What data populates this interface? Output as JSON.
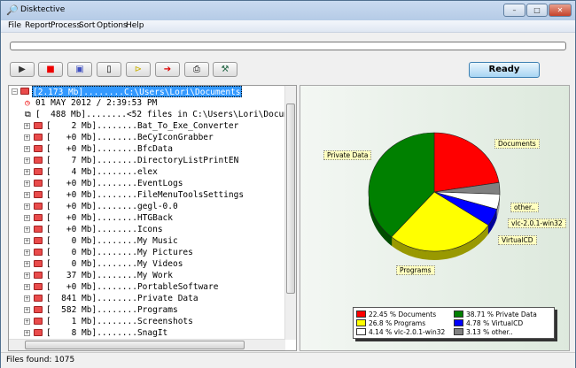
{
  "window": {
    "title": "Disktective",
    "min": "–",
    "max": "□",
    "close": "✕"
  },
  "menu": [
    "File",
    "Report",
    "Process",
    "Sort",
    "Options",
    "Help"
  ],
  "toolbar": {
    "buttons": [
      "play-icon",
      "stop-icon",
      "save-icon",
      "new-document-icon",
      "open-folder-icon",
      "export-icon",
      "print-icon",
      "tools-icon"
    ],
    "status_button": "Ready"
  },
  "progress": 0,
  "tree": {
    "root": "[2.173 Mb]........C:\\Users\\Lori\\Documents",
    "date": "01 MAY 2012 / 2:39:53 PM",
    "files": "[  488 Mb]........<52 files in C:\\Users\\Lori\\Documents>",
    "items": [
      "[    2 Mb]........Bat_To_Exe_Converter",
      "[   +0 Mb]........BeCyIconGrabber",
      "[   +0 Mb]........BfcData",
      "[    7 Mb]........DirectoryListPrintEN",
      "[    4 Mb]........elex",
      "[   +0 Mb]........EventLogs",
      "[   +0 Mb]........FileMenuToolsSettings",
      "[   +0 Mb]........gegl-0.0",
      "[   +0 Mb]........HTGBack",
      "[   +0 Mb]........Icons",
      "[    0 Mb]........My Music",
      "[    0 Mb]........My Pictures",
      "[    0 Mb]........My Videos",
      "[   37 Mb]........My Work",
      "[   +0 Mb]........PortableSoftware",
      "[  841 Mb]........Private Data",
      "[  582 Mb]........Programs",
      "[    1 Mb]........Screenshots",
      "[    8 Mb]........SnagIt"
    ]
  },
  "chart_data": {
    "type": "pie",
    "slices": [
      {
        "label": "Documents",
        "value": 22.45,
        "color": "#ff0000",
        "legend": "22.45 % Documents"
      },
      {
        "label": "other..",
        "value": 3.13,
        "color": "#808080",
        "legend": "3.13 % other.."
      },
      {
        "label": "vlc-2.0.1-win32",
        "value": 4.14,
        "color": "#ffffff",
        "legend": "4.14 % vlc-2.0.1-win32"
      },
      {
        "label": "VirtualCD",
        "value": 4.78,
        "color": "#0000ff",
        "legend": "4.78 % VirtualCD"
      },
      {
        "label": "Programs",
        "value": 26.8,
        "color": "#ffff00",
        "legend": "26.8 % Programs"
      },
      {
        "label": "Private Data",
        "value": 38.71,
        "color": "#008000",
        "legend": "38.71 % Private Data"
      }
    ],
    "legend": "bottom"
  },
  "status": {
    "files_found": "Files found: 1075"
  }
}
